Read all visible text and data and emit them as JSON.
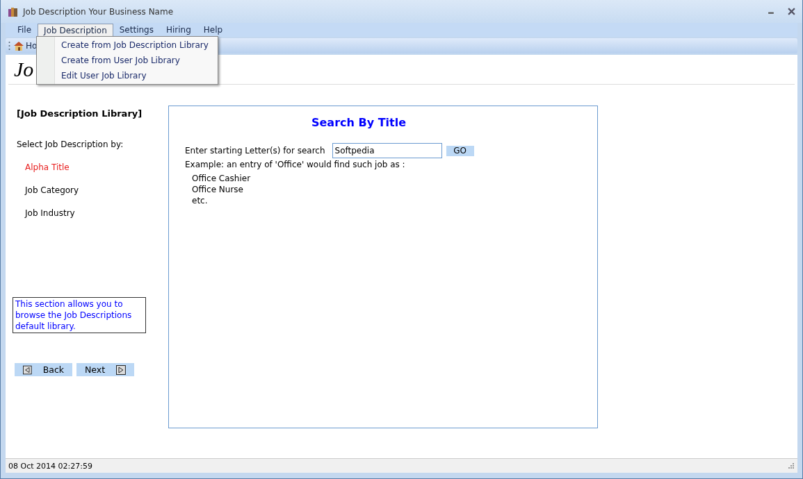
{
  "window": {
    "title": "Job Description Your Business Name"
  },
  "menu": [
    {
      "label": "File",
      "selected": false
    },
    {
      "label": "Job Description",
      "selected": true
    },
    {
      "label": "Settings",
      "selected": false
    },
    {
      "label": "Hiring",
      "selected": false
    },
    {
      "label": "Help",
      "selected": false
    }
  ],
  "dropdown": [
    "Create from Job Description Library",
    "Create from User Job Library",
    "Edit User Job Library"
  ],
  "toolbar": {
    "home": "Ho"
  },
  "header": "Jo",
  "sidebar": {
    "title": "[Job Description Library]",
    "prompt": "Select Job Description by:",
    "items": [
      {
        "label": "Alpha Title",
        "selected": true
      },
      {
        "label": "Job Category",
        "selected": false
      },
      {
        "label": "Job Industry",
        "selected": false
      }
    ],
    "info": "This section allows you to browse the Job Descriptions default library.",
    "back": "Back",
    "next": "Next"
  },
  "search": {
    "title": "Search By Title",
    "label": "Enter starting Letter(s) for search",
    "value": "Softpedia",
    "go": "GO",
    "example": "Example: an entry of 'Office' would find such job as :",
    "examples": [
      "Office Cashier",
      "Office Nurse",
      "etc."
    ]
  },
  "status_bar": "08 Oct 2014 02:27:59"
}
